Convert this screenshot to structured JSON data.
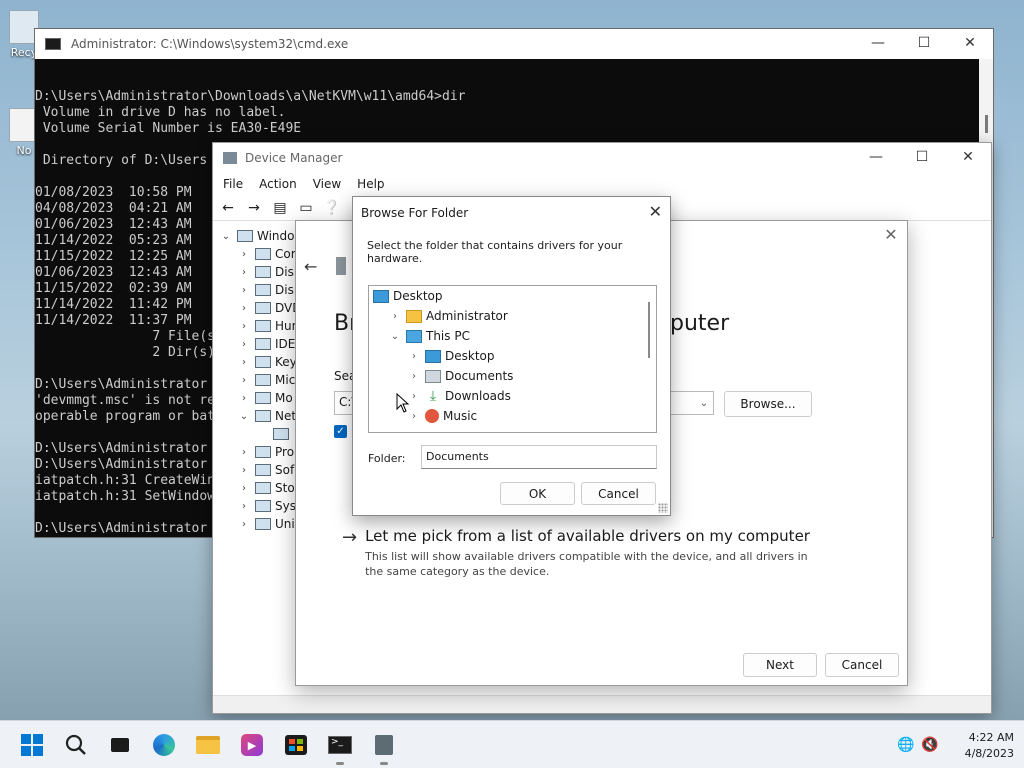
{
  "desktop": {
    "icons": [
      {
        "label": "Recy",
        "name": "recycle-bin"
      },
      {
        "label": "No",
        "name": "notepad"
      }
    ]
  },
  "cmd": {
    "title": "Administrator: C:\\Windows\\system32\\cmd.exe",
    "lines": [
      "D:\\Users\\Administrator\\Downloads\\a\\NetKVM\\w11\\amd64>dir",
      " Volume in drive D has no label.",
      " Volume Serial Number is EA30-E49E",
      "",
      " Directory of D:\\Users",
      "",
      "01/08/2023  10:58 PM",
      "04/08/2023  04:21 AM",
      "01/06/2023  12:43 AM",
      "11/14/2022  05:23 AM",
      "11/15/2022  12:25 AM",
      "01/06/2023  12:43 AM",
      "11/15/2022  02:39 AM",
      "11/14/2022  11:42 PM",
      "11/14/2022  11:37 PM",
      "               7 File(s",
      "               2 Dir(s)",
      "",
      "D:\\Users\\Administrator",
      "'devmmgt.msc' is not re",
      "operable program or bat",
      "",
      "D:\\Users\\Administrator",
      "D:\\Users\\Administrator",
      "iatpatch.h:31 CreateWin",
      "iatpatch.h:31 SetWindow",
      "",
      "D:\\Users\\Administrator"
    ]
  },
  "devmgr": {
    "title": "Device Manager",
    "menu": [
      "File",
      "Action",
      "View",
      "Help"
    ],
    "tree": [
      {
        "label": "Window",
        "chev": "v",
        "level": 0
      },
      {
        "label": "Cor",
        "chev": ">",
        "level": 1
      },
      {
        "label": "Disk",
        "chev": ">",
        "level": 1
      },
      {
        "label": "Disp",
        "chev": ">",
        "level": 1
      },
      {
        "label": "DVD",
        "chev": ">",
        "level": 1
      },
      {
        "label": "Hum",
        "chev": ">",
        "level": 1
      },
      {
        "label": "IDE",
        "chev": ">",
        "level": 1
      },
      {
        "label": "Key",
        "chev": ">",
        "level": 1
      },
      {
        "label": "Mic",
        "chev": ">",
        "level": 1
      },
      {
        "label": "Mo",
        "chev": ">",
        "level": 1
      },
      {
        "label": "Net",
        "chev": "v",
        "level": 1
      },
      {
        "label": "",
        "chev": "",
        "level": 2
      },
      {
        "label": "Pro",
        "chev": ">",
        "level": 1
      },
      {
        "label": "Sof",
        "chev": ">",
        "level": 1
      },
      {
        "label": "Sto",
        "chev": ">",
        "level": 1
      },
      {
        "label": "Sys",
        "chev": ">",
        "level": 1
      },
      {
        "label": "Uni",
        "chev": ">",
        "level": 1
      }
    ]
  },
  "wizard": {
    "heading_start": "Br",
    "heading_end": "puter",
    "search_label": "Sea",
    "path_value": "C:\\",
    "browse_label": "Browse...",
    "pick_title": "Let me pick from a list of available drivers on my computer",
    "pick_desc": "This list will show available drivers compatible with the device, and all drivers in the same category as the device.",
    "next_label": "Next",
    "cancel_label": "Cancel"
  },
  "browse": {
    "title": "Browse For Folder",
    "instruction": "Select the folder that contains drivers for your hardware.",
    "items": [
      {
        "label": "Desktop",
        "icon": "desktop",
        "chev": ""
      },
      {
        "label": "Administrator",
        "icon": "folder",
        "chev": ">"
      },
      {
        "label": "This PC",
        "icon": "pc",
        "chev": "v"
      },
      {
        "label": "Desktop",
        "icon": "desktop",
        "chev": ">"
      },
      {
        "label": "Documents",
        "icon": "docs",
        "chev": ">"
      },
      {
        "label": "Downloads",
        "icon": "down",
        "chev": ">"
      },
      {
        "label": "Music",
        "icon": "music",
        "chev": ">"
      }
    ],
    "folder_label": "Folder:",
    "folder_value": "Documents",
    "ok_label": "OK",
    "cancel_label": "Cancel"
  },
  "taskbar": {
    "apps": [
      "start",
      "search",
      "task-view",
      "edge",
      "file-explorer",
      "media-player",
      "store",
      "terminal",
      "device-manager"
    ],
    "time": "4:22 AM",
    "date": "4/8/2023"
  },
  "colors": {
    "accent": "#0067c0",
    "terminal_bg": "#0c0c0c",
    "terminal_fg": "#cccccc"
  }
}
